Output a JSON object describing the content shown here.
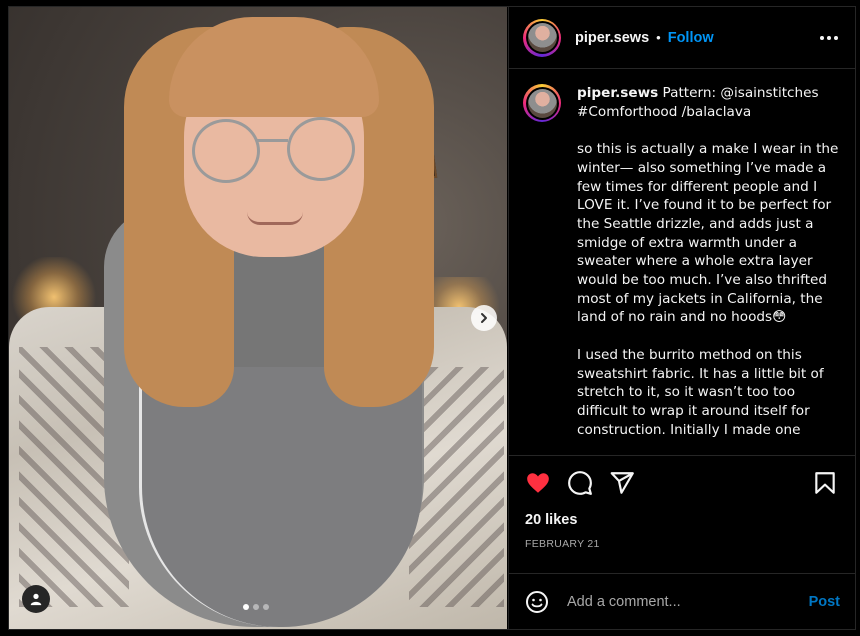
{
  "post": {
    "username": "piper.sews",
    "separator": "•",
    "follow_label": "Follow",
    "caption_username": "piper.sews",
    "caption_first": " Pattern: @isainstitches #Comforthood /balaclava",
    "caption_para1": "so this is actually a make I wear in the winter— also something I’ve made a few times for different people and I LOVE it. I’ve found it to be perfect for the Seattle drizzle, and adds just a smidge of extra warmth under a sweater where a whole extra layer would be too much. I’ve also thrifted most of my jackets in California, the land of no rain and no hoods😳",
    "caption_para2": "I used the burrito method on this sweatshirt fabric. It has a little bit of stretch to it, so it wasn’t too too difficult to wrap it around itself for construction. Initially I made one",
    "likes": "20 likes",
    "date": "FEBRUARY 21",
    "carousel": {
      "count": 3,
      "active": 0
    }
  },
  "comment": {
    "placeholder": "Add a comment...",
    "post_label": "Post"
  },
  "icons": {
    "like": "heart-icon",
    "comment": "comment-icon",
    "share": "share-icon",
    "save": "bookmark-icon",
    "emoji": "emoji-icon",
    "more": "more-icon",
    "next": "chevron-right-icon",
    "tag": "user-tag-icon"
  },
  "colors": {
    "accent": "#0095f6",
    "like": "#ff3040",
    "background": "#000000",
    "border": "#262626"
  }
}
